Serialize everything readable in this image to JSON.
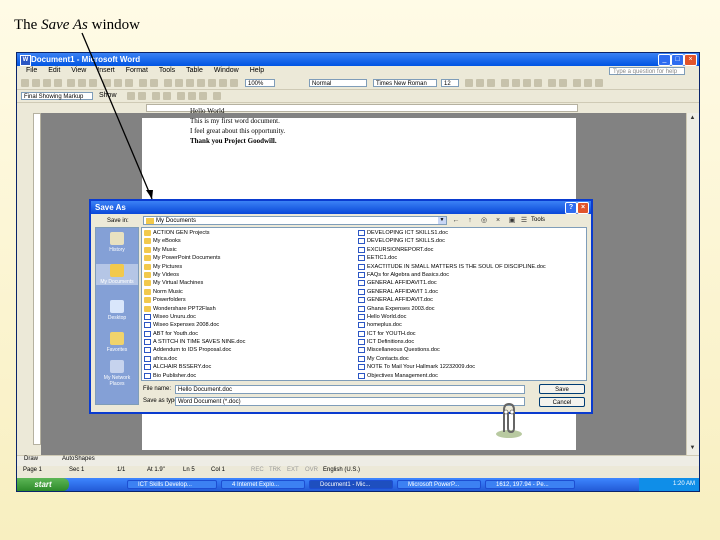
{
  "slide": {
    "title_prefix": "The ",
    "title_em": "Save As",
    "title_suffix": " window"
  },
  "word": {
    "title": "Document1 - Microsoft Word",
    "menu": [
      "File",
      "Edit",
      "View",
      "Insert",
      "Format",
      "Tools",
      "Table",
      "Window",
      "Help"
    ],
    "help_placeholder": "Type a question for help",
    "zoom": "100%",
    "style": "Normal",
    "font": "Times New Roman",
    "size": "12",
    "review_label": "Final Showing Markup",
    "show_label": "Show",
    "document_lines": [
      "Hello World",
      "This is my first word document.",
      "I feel great about this opportunity.",
      "Thank you Project Goodwill."
    ],
    "status": {
      "page": "Page 1",
      "section": "Sec 1",
      "pages": "1/1",
      "at": "At 1.9\"",
      "ln": "Ln 5",
      "col": "Col 1",
      "rec": "REC",
      "trk": "TRK",
      "ext": "EXT",
      "ovr": "OVR",
      "lang": "English (U.S.)"
    },
    "draw_label": "Draw",
    "autoshapes_label": "AutoShapes"
  },
  "taskbar": {
    "start": "start",
    "tasks": [
      "ICT Skills Develop...",
      "4 Internet Explo...",
      "Document1 - Mic...",
      "Microsoft PowerP...",
      "1612, 197.94 - Pe..."
    ],
    "clock": "1:20 AM"
  },
  "dialog": {
    "title": "Save As",
    "save_in_label": "Save in:",
    "save_in_value": "My Documents",
    "tools_label": "Tools",
    "places": [
      "History",
      "My Documents",
      "Desktop",
      "Favorites",
      "My Network Places"
    ],
    "files_col1": [
      "ACTION GEN Projects",
      "My eBooks",
      "My Music",
      "My PowerPoint Documents",
      "My Pictures",
      "My Videos",
      "My Virtual Machines",
      "Norm Music",
      "Powerfolders",
      "Wondershare PPT2Flash",
      "Wiseo Unuru.doc",
      "Wiseo Expenses 2008.doc",
      "ABT for Youth.doc",
      "A STITCH IN TIME SAVES NINE.doc",
      "Addendum to IDS Proposal.doc",
      "africa.doc",
      "ALCHAIR BSSERY.doc",
      "Bio Publisher.doc",
      "Black Unuru.doc",
      "Compiling and Running REAL.doc",
      "Curricula Tutorial.doc"
    ],
    "files_col2": [
      "DEVELOPING ICT SKILLS1.doc",
      "DEVELOPING ICT SKILLS.doc",
      "EXCURSIONREPORT.doc",
      "EETIC1.doc",
      "EXACTITUDE IN SMALL MATTERS IS THE SOUL OF DISCIPLINE.doc",
      "FAQs for Algebra and Basics.doc",
      "GENERAL AFFIDAVIT1.doc",
      "GENERAL AFFIDAVIT 1.doc",
      "GENERAL AFFIDAVIT.doc",
      "Ghana Expenses 2003.doc",
      "Hello World.doc",
      "homeplus.doc",
      "ICT for YOUTH.doc",
      "ICT Definitions.doc",
      "Miscellaneous Questions.doc",
      "My Contacts.doc",
      "NOTE To Mail Your Hallmark 12232009.doc",
      "Objectives Management.doc",
      "ORGANIZE IN THOUGHTS.doc",
      "ORGANIZE MENTALLY.doc",
      "Party Shuffle 2009.doc"
    ],
    "highlighted_file": "My Documents",
    "file_name_label": "File name:",
    "file_name_value": "Hello Document.doc",
    "save_as_type_label": "Save as type:",
    "save_as_type_value": "Word Document (*.doc)",
    "save_button": "Save",
    "cancel_button": "Cancel"
  }
}
